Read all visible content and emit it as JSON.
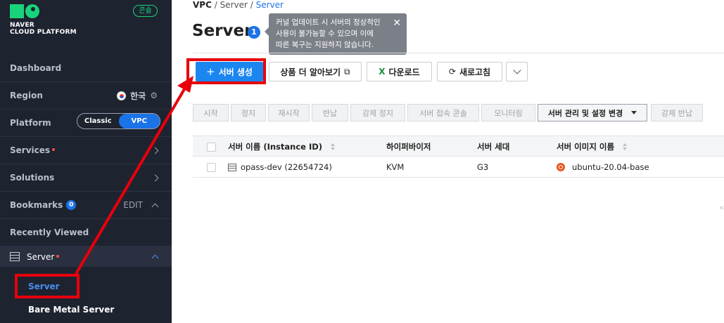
{
  "brand": {
    "line1": "NAVER",
    "line2": "CLOUD PLATFORM",
    "console_badge": "콘솔",
    "brand_color": "#17d47a"
  },
  "sidebar": {
    "dashboard": "Dashboard",
    "region": {
      "label": "Region",
      "value": "한국"
    },
    "platform": {
      "label": "Platform",
      "options": [
        "Classic",
        "VPC"
      ],
      "selected": "VPC"
    },
    "services": "Services",
    "solutions": "Solutions",
    "bookmarks": {
      "label": "Bookmarks",
      "count": "0",
      "edit": "EDIT"
    },
    "recently_viewed": "Recently Viewed",
    "server_group": "Server",
    "sub_items": [
      "Server",
      "Bare Metal Server"
    ]
  },
  "breadcrumb": {
    "root": "VPC",
    "mid": "Server",
    "current": "Server"
  },
  "page": {
    "title": "Server",
    "info_number": "1",
    "tooltip": [
      "커널 업데이트 시 서버의 정상적인",
      "사용이 불가능할 수 있으며 이에",
      "따른 복구는 지원하지 않습니다."
    ]
  },
  "toolbar": {
    "create": "서버 생성",
    "learn_more": "상품 더 알아보기",
    "download": "다운로드",
    "refresh": "새로고침"
  },
  "actions": {
    "start": "시작",
    "stop": "정지",
    "restart": "재시작",
    "return": "반납",
    "force_stop": "강제 정지",
    "console": "서버 접속 콘솔",
    "monitoring": "모니터링",
    "manage": "서버 관리 및 설정 변경",
    "force_return": "강제 반납"
  },
  "table": {
    "headers": {
      "name": "서버 이름 (Instance ID)",
      "hypervisor": "하이퍼바이저",
      "generation": "서버 세대",
      "image": "서버 이미지 이름"
    },
    "rows": [
      {
        "name": "opass-dev (22654724)",
        "hypervisor": "KVM",
        "generation": "G3",
        "image": "ubuntu-20.04-base"
      }
    ]
  },
  "colors": {
    "accent": "#1b86f0",
    "annotation": "#e8000b",
    "sidebar_bg": "#1e2330"
  }
}
